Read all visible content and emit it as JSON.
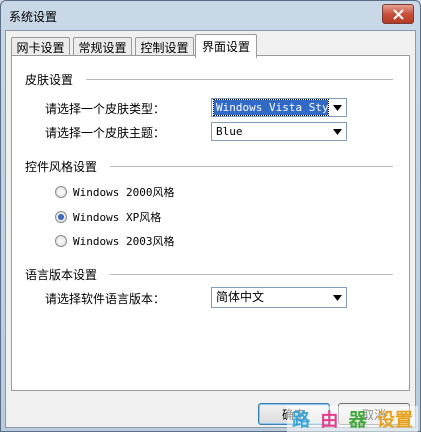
{
  "window": {
    "title": "系统设置"
  },
  "tabs": [
    {
      "label": "网卡设置"
    },
    {
      "label": "常规设置"
    },
    {
      "label": "控制设置"
    },
    {
      "label": "界面设置"
    }
  ],
  "skin_group": {
    "title": "皮肤设置",
    "type_label": "请选择一个皮肤类型：",
    "type_value": "Windows Vista Style",
    "theme_label": "请选择一个皮肤主题：",
    "theme_value": "Blue"
  },
  "style_group": {
    "title": "控件风格设置",
    "options": [
      {
        "label": "Windows 2000风格",
        "checked": false
      },
      {
        "label": "Windows XP风格",
        "checked": true
      },
      {
        "label": "Windows 2003风格",
        "checked": false
      }
    ]
  },
  "language_group": {
    "title": "语言版本设置",
    "label": "请选择软件语言版本：",
    "value": "简体中文"
  },
  "buttons": {
    "ok": "确定",
    "cancel": "取消"
  },
  "watermark": [
    "路",
    "由",
    "器",
    "设置"
  ],
  "colors": {
    "selection": "#3169c6",
    "close": "#c7503b"
  }
}
